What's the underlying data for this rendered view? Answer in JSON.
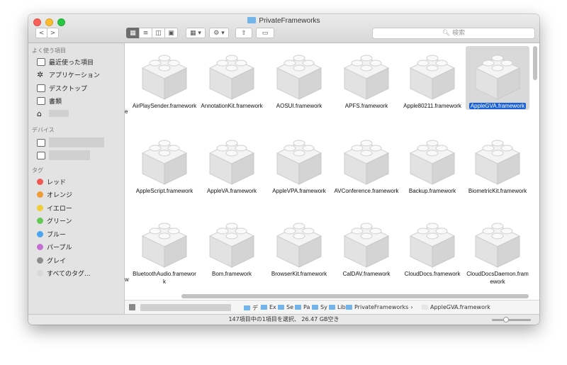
{
  "window": {
    "title": "PrivateFrameworks"
  },
  "toolbar": {
    "back": "<",
    "forward": ">",
    "views": [
      "▦",
      "≡",
      "◫",
      "▣"
    ],
    "arrange": "▦ ▾",
    "action": "⚙ ▾",
    "share": "⇧",
    "tag": "▭",
    "search_placeholder": "検索"
  },
  "sidebar": {
    "favorites_title": "よく使う項目",
    "favorites": [
      {
        "label": "最近使った項目"
      },
      {
        "label": "アプリケーション"
      },
      {
        "label": "デスクトップ"
      },
      {
        "label": "書類"
      }
    ],
    "devices_title": "デバイス",
    "tags_title": "タグ",
    "tags": [
      {
        "label": "レッド",
        "color": "#ee5a52"
      },
      {
        "label": "オレンジ",
        "color": "#f19a38"
      },
      {
        "label": "イエロー",
        "color": "#f0cd34"
      },
      {
        "label": "グリーン",
        "color": "#64c957"
      },
      {
        "label": "ブルー",
        "color": "#4aa5f0"
      },
      {
        "label": "パープル",
        "color": "#c46fd6"
      },
      {
        "label": "グレイ",
        "color": "#8e8e8e"
      },
      {
        "label": "すべてのタグ...",
        "color": "#d8d8d8"
      }
    ]
  },
  "files": [
    [
      "AirPlaySender.framework",
      "AnnotationKit.framework",
      "AOSUI.framework",
      "APFS.framework",
      "Apple80211.framework",
      "AppleGVA.framework"
    ],
    [
      "AppleScript.framework",
      "AppleVA.framework",
      "AppleVPA.framework",
      "AVConference.framework",
      "Backup.framework",
      "BiometricKit.framework"
    ],
    [
      "BluetoothAudio.framework",
      "Bom.framework",
      "BrowserKit.framework",
      "CalDAV.framework",
      "CloudDocs.framework",
      "CloudDocsDaemon.framework"
    ]
  ],
  "selected_file": "AppleGVA.framework",
  "edge_labels": [
    "e",
    "",
    "w"
  ],
  "pathbar": {
    "crumbs": [
      "デ",
      "Ex",
      "Se",
      "Pa",
      "Sy",
      "Lib",
      "PrivateFrameworks",
      "AppleGVA.framework"
    ]
  },
  "status": {
    "text": "147項目中の1項目を選択、 26.47 GB空き",
    "zoom_level": 0.35
  }
}
